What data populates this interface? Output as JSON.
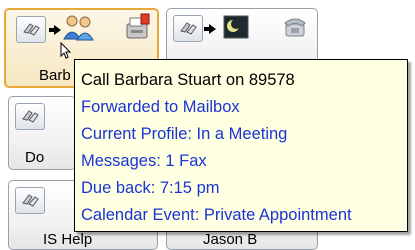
{
  "contacts": [
    {
      "label": "Barb",
      "state": "selected"
    },
    {
      "label": "",
      "state": "normal"
    },
    {
      "label": "Do",
      "state": "normal"
    },
    {
      "label": "IS Help",
      "state": "normal"
    },
    {
      "label": "Jason B",
      "state": "normal"
    }
  ],
  "tooltip": {
    "call": "Call Barbara Stuart on 89578",
    "forwarded": "Forwarded to Mailbox",
    "profile": "Current Profile: In a Meeting",
    "messages": "Messages: 1 Fax",
    "due_back": "Due back: 7:15 pm",
    "calendar": "Calendar Event: Private Appointment"
  },
  "icons": {
    "forward_arrow": "forward-arrow-icon",
    "phone": "phone-icon",
    "people": "people-icon",
    "night": "night-moon-icon",
    "fax": "fax-icon",
    "telephone": "telephone-icon"
  },
  "colors": {
    "tooltip_bg": "#ffffe1",
    "tooltip_text": "#1a34d6",
    "selected_border": "#e6a93a"
  }
}
